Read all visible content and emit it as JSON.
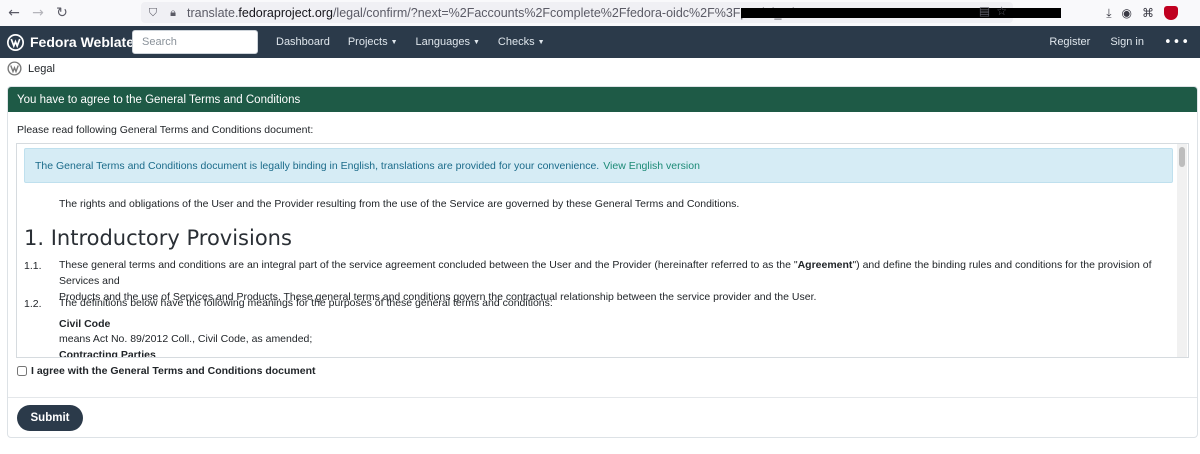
{
  "browser": {
    "url_prefix": "translate.",
    "url_domain": "fedoraproject.org",
    "url_path": "/legal/confirm/?next=%2Faccounts%2Fcomplete%2Ffedora-oidc%2F%3Fpartial_token%3D"
  },
  "navbar": {
    "brand": "Fedora Weblate",
    "search_placeholder": "Search",
    "links": [
      "Dashboard",
      "Projects",
      "Languages",
      "Checks"
    ],
    "register": "Register",
    "sign_in": "Sign in",
    "more": "•••"
  },
  "breadcrumb": {
    "label": "Legal"
  },
  "card": {
    "header": "You have to agree to the General Terms and Conditions",
    "intro": "Please read following General Terms and Conditions document:",
    "alert_text": "The General Terms and Conditions document is legally binding in English, translations are provided for your convenience.",
    "alert_link": "View English version",
    "preamble": "The rights and obligations of the User and the Provider resulting from the use of the Service are governed by these General Terms and Conditions.",
    "section_title": "1. Introductory Provisions",
    "items": [
      {
        "num": "1.1.",
        "text_a": "These general terms and conditions are an integral part of the service agreement concluded between the User and the Provider (hereinafter referred to as the \"",
        "text_bold": "Agreement",
        "text_b": "\") and define the binding rules and conditions for the provision of Services and",
        "text_line2": "Products and the use of Services and Products. These general terms and conditions govern the contractual relationship between the service provider and the User."
      },
      {
        "num": "1.2.",
        "text": "The definitions below have the following meanings for the purposes of these general terms and conditions:"
      }
    ],
    "definitions": [
      {
        "term": "Civil Code",
        "meaning": "means Act No. 89/2012 Coll., Civil Code, as amended;"
      },
      {
        "term": "Contracting Parties",
        "meaning": ""
      }
    ],
    "checkbox_label": "I agree with the General Terms and Conditions document",
    "submit_label": "Submit"
  },
  "colors": {
    "navbar": "#2b3a4a",
    "card_header": "#1e5a46",
    "alert_bg": "#d6ecf5",
    "link": "#1c8a76"
  }
}
